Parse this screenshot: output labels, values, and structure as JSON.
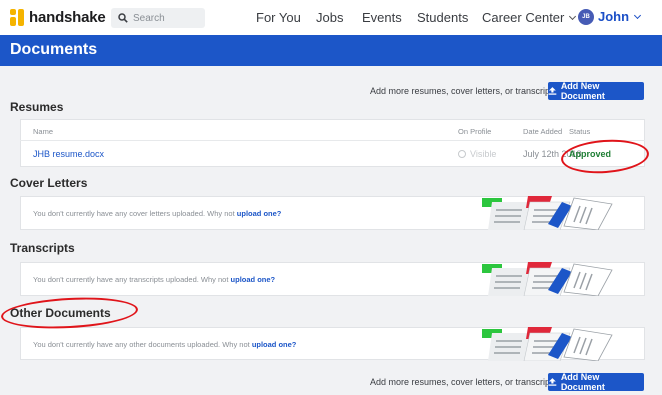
{
  "nav": {
    "logo_text": "handshake",
    "search_placeholder": "Search",
    "links": [
      "For You",
      "Jobs",
      "Events",
      "Students",
      "Career Center"
    ],
    "user_initials": "JB",
    "user_name": "John"
  },
  "header": {
    "title": "Documents"
  },
  "add_prompt": "Add more resumes, cover letters, or transcripts",
  "add_button_label": "Add New Document",
  "resumes": {
    "title": "Resumes",
    "columns": {
      "name": "Name",
      "on_profile": "On Profile",
      "date_added": "Date Added",
      "status": "Status"
    },
    "rows": [
      {
        "name": "JHB resume.docx",
        "on_profile": "Visible",
        "date_added": "July 12th 2018",
        "status": "Approved"
      }
    ]
  },
  "cover_letters": {
    "title": "Cover Letters",
    "empty_text": "You don't currently have any cover letters uploaded. Why not",
    "link_text": "upload one?"
  },
  "transcripts": {
    "title": "Transcripts",
    "empty_text": "You don't currently have any transcripts uploaded. Why not",
    "link_text": "upload one?"
  },
  "other_documents": {
    "title": "Other Documents",
    "empty_text": "You don't currently have any other documents uploaded. Why not",
    "link_text": "upload one?"
  },
  "colors": {
    "brand_blue": "#1c56c8",
    "approved_green": "#1e7e34",
    "annotation_red": "#e0141a",
    "logo_yellow": "#f5b400"
  }
}
